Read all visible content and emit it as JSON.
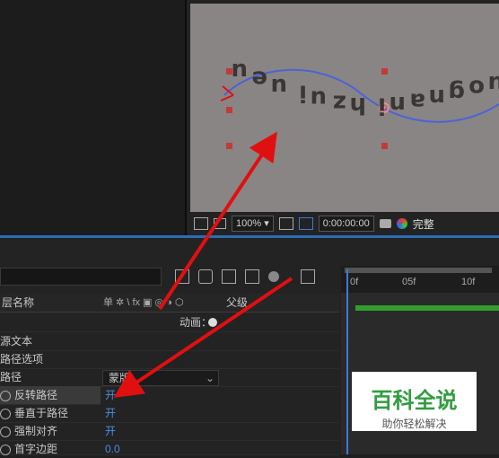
{
  "viewer": {
    "text_chars": [
      "u",
      "e",
      "u",
      "i",
      "u",
      "z",
      "h",
      "i",
      "n",
      "a",
      "n",
      "g",
      "o",
      "u"
    ],
    "zoom": "100%",
    "timecode": "0:00:00:00",
    "quality": "完整"
  },
  "timeline": {
    "header": {
      "layer_name": "层名称",
      "switches": "单 ✲ \\ fx ▣ ◎ ◑ ⬡",
      "parent": "父级"
    },
    "animate_label": "动画：",
    "rows": [
      {
        "label": "源文本"
      },
      {
        "label": "路径选项"
      },
      {
        "label": "路径",
        "value": "蒙版"
      },
      {
        "label": "反转路径",
        "value": "开"
      },
      {
        "label": "垂直于路径",
        "value": "开"
      },
      {
        "label": "强制对齐",
        "value": "开"
      },
      {
        "label": "首字边距",
        "value": "0.0"
      }
    ],
    "ruler": {
      "t0": "0f",
      "t1": "05f",
      "t2": "10f"
    }
  },
  "watermark": {
    "title": "百科全说",
    "subtitle": "助你轻松解决"
  },
  "colors": {
    "accent": "#2c6cb7",
    "value_blue": "#4c8ee6",
    "arrow_red": "#e01010",
    "path_blue": "#4a63d8"
  }
}
